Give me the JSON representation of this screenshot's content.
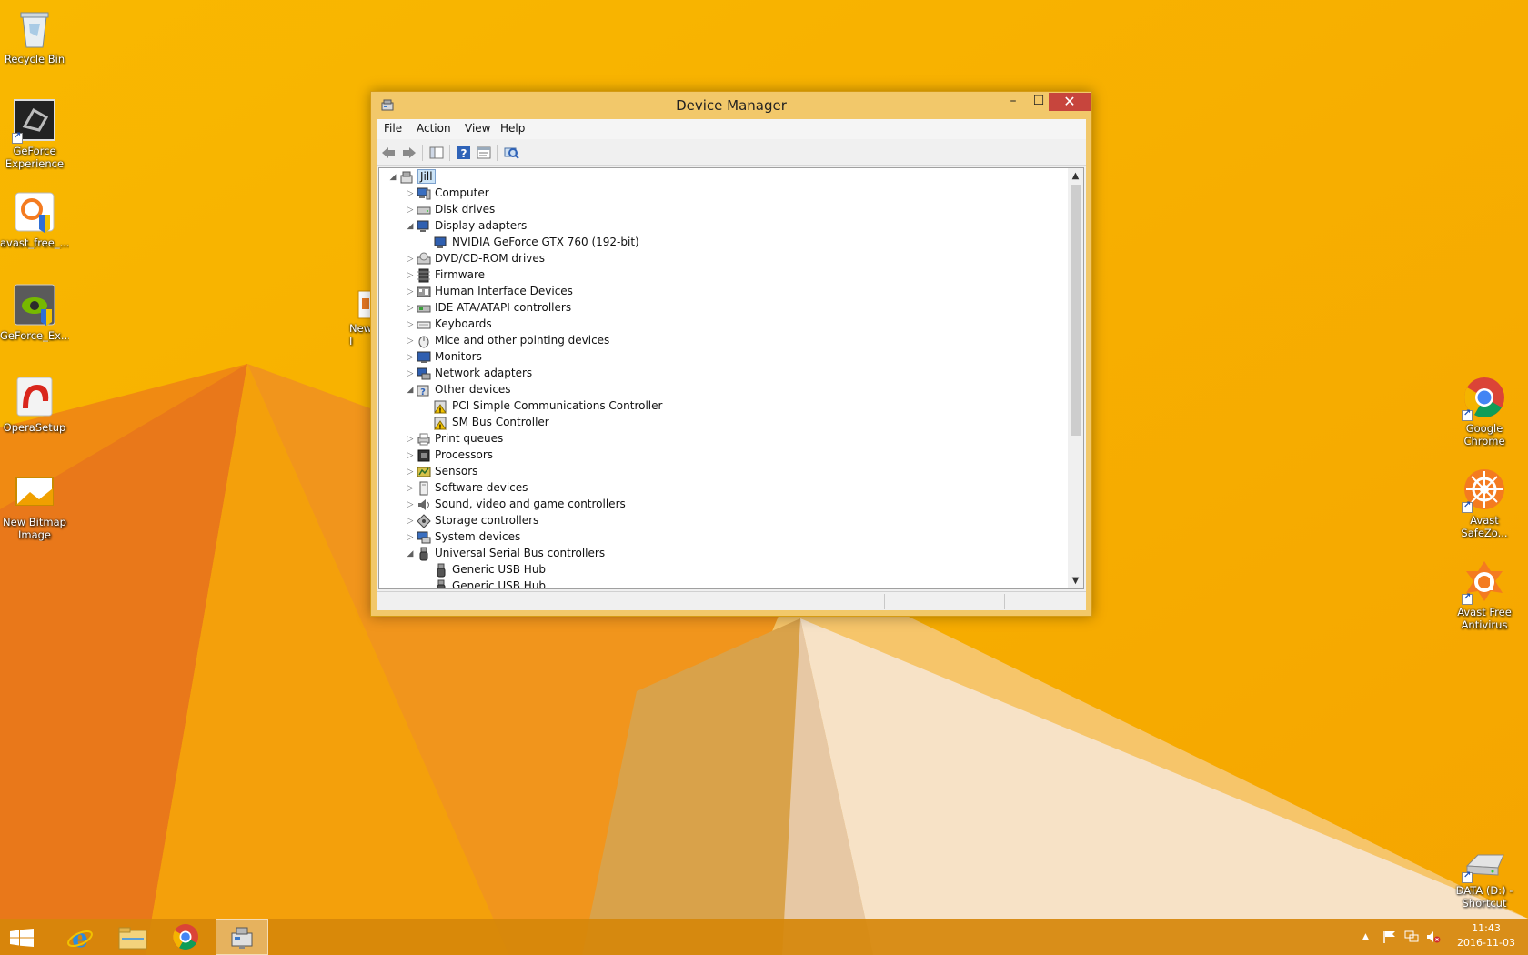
{
  "desktop": {
    "left_icons": [
      {
        "label": "Recycle Bin",
        "icon": "recycle-bin-icon"
      },
      {
        "label": "GeForce\nExperience",
        "icon": "geforce-experience-icon"
      },
      {
        "label": "avast_free_...",
        "icon": "avast-installer-icon"
      },
      {
        "label": "GeForce_Ex...",
        "icon": "geforce-installer-icon"
      },
      {
        "label": "OperaSetup",
        "icon": "opera-setup-icon"
      },
      {
        "label": "New Bitmap\nImage",
        "icon": "bitmap-image-icon"
      }
    ],
    "partial_icon": {
      "label": "New\nI"
    },
    "right_icons": [
      {
        "label": "Google\nChrome",
        "icon": "chrome-icon"
      },
      {
        "label": "Avast\nSafeZo...",
        "icon": "avast-safezone-icon"
      },
      {
        "label": "Avast Free\nAntivirus",
        "icon": "avast-antivirus-icon"
      },
      {
        "label": "DATA (D:) -\nShortcut",
        "icon": "drive-shortcut-icon"
      }
    ]
  },
  "window": {
    "title": "Device Manager",
    "buttons": {
      "minimize": "–",
      "maximize": "☐",
      "close": "✕"
    },
    "menu": [
      "File",
      "Action",
      "View",
      "Help"
    ],
    "toolbar": [
      "back-icon",
      "forward-icon",
      "show-hide-tree-icon",
      "help-icon",
      "properties-icon",
      "scan-hardware-icon"
    ],
    "tree": [
      {
        "label": "Jill",
        "level": 0,
        "expander": "expanded",
        "icon": "computer-root-icon",
        "selected": true
      },
      {
        "label": "Computer",
        "level": 1,
        "expander": "collapsed",
        "icon": "computer-icon"
      },
      {
        "label": "Disk drives",
        "level": 1,
        "expander": "collapsed",
        "icon": "disk-drive-icon"
      },
      {
        "label": "Display adapters",
        "level": 1,
        "expander": "expanded",
        "icon": "display-adapter-icon"
      },
      {
        "label": "NVIDIA GeForce GTX 760 (192-bit)",
        "level": 2,
        "expander": "none",
        "icon": "display-adapter-icon"
      },
      {
        "label": "DVD/CD-ROM drives",
        "level": 1,
        "expander": "collapsed",
        "icon": "dvd-icon"
      },
      {
        "label": "Firmware",
        "level": 1,
        "expander": "collapsed",
        "icon": "firmware-icon"
      },
      {
        "label": "Human Interface Devices",
        "level": 1,
        "expander": "collapsed",
        "icon": "hid-icon"
      },
      {
        "label": "IDE ATA/ATAPI controllers",
        "level": 1,
        "expander": "collapsed",
        "icon": "ide-controller-icon"
      },
      {
        "label": "Keyboards",
        "level": 1,
        "expander": "collapsed",
        "icon": "keyboard-icon"
      },
      {
        "label": "Mice and other pointing devices",
        "level": 1,
        "expander": "collapsed",
        "icon": "mouse-icon"
      },
      {
        "label": "Monitors",
        "level": 1,
        "expander": "collapsed",
        "icon": "monitor-icon"
      },
      {
        "label": "Network adapters",
        "level": 1,
        "expander": "collapsed",
        "icon": "network-adapter-icon"
      },
      {
        "label": "Other devices",
        "level": 1,
        "expander": "expanded",
        "icon": "other-devices-icon"
      },
      {
        "label": "PCI Simple Communications Controller",
        "level": 2,
        "expander": "none",
        "icon": "warning-device-icon"
      },
      {
        "label": "SM Bus Controller",
        "level": 2,
        "expander": "none",
        "icon": "warning-device-icon"
      },
      {
        "label": "Print queues",
        "level": 1,
        "expander": "collapsed",
        "icon": "printer-icon"
      },
      {
        "label": "Processors",
        "level": 1,
        "expander": "collapsed",
        "icon": "processor-icon"
      },
      {
        "label": "Sensors",
        "level": 1,
        "expander": "collapsed",
        "icon": "sensor-icon"
      },
      {
        "label": "Software devices",
        "level": 1,
        "expander": "collapsed",
        "icon": "software-device-icon"
      },
      {
        "label": "Sound, video and game controllers",
        "level": 1,
        "expander": "collapsed",
        "icon": "sound-icon"
      },
      {
        "label": "Storage controllers",
        "level": 1,
        "expander": "collapsed",
        "icon": "storage-controller-icon"
      },
      {
        "label": "System devices",
        "level": 1,
        "expander": "collapsed",
        "icon": "system-device-icon"
      },
      {
        "label": "Universal Serial Bus controllers",
        "level": 1,
        "expander": "expanded",
        "icon": "usb-icon"
      },
      {
        "label": "Generic USB Hub",
        "level": 2,
        "expander": "none",
        "icon": "usb-icon"
      },
      {
        "label": "Generic USB Hub",
        "level": 2,
        "expander": "none",
        "icon": "usb-icon"
      }
    ],
    "scrollbar": {
      "up": "▲",
      "down": "▼"
    }
  },
  "taskbar": {
    "buttons": [
      "start-icon",
      "internet-explorer-icon",
      "file-explorer-icon",
      "chrome-icon",
      "device-manager-icon"
    ],
    "tray": [
      "show-hidden-icons-icon",
      "action-center-flag-icon",
      "network-icon",
      "volume-muted-icon"
    ],
    "tray_arrow": "▲",
    "clock": {
      "time": "11:43",
      "date": "2016-11-03"
    }
  },
  "colors": {
    "wallpaper": "#f7b300",
    "titlebar": "#f2c86a",
    "close_button": "#c7453d",
    "taskbar": "#d6870a"
  }
}
